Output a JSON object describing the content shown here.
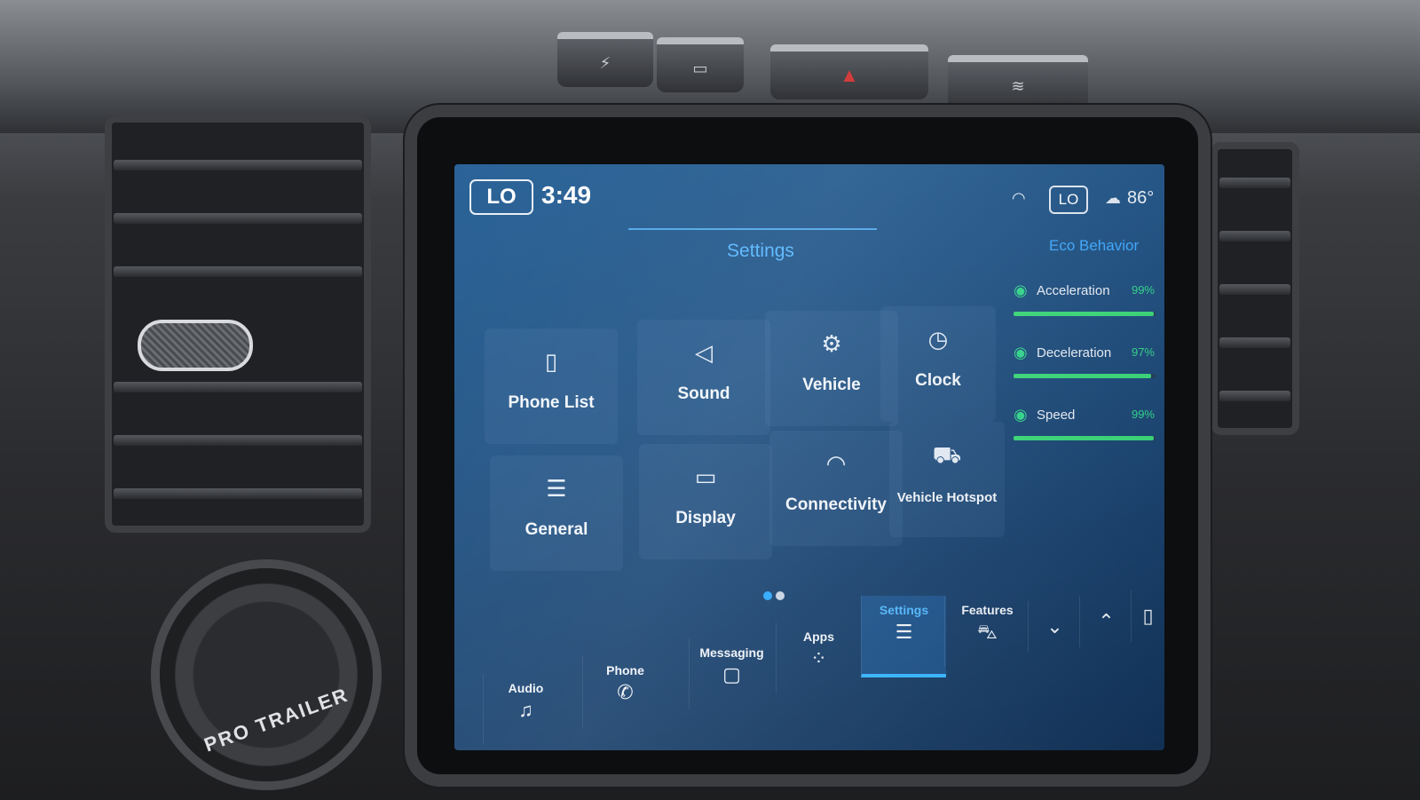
{
  "hardware": {
    "hazard_icon": "hazard-triangle-icon",
    "pro_trailer_label": "PRO TRAILER"
  },
  "status_bar": {
    "left_badge": "LO",
    "time": "3:49",
    "right_badge": "LO",
    "temperature": "86°"
  },
  "page": {
    "title": "Settings"
  },
  "tiles": [
    {
      "label": "Phone List",
      "icon": "phone-list-icon"
    },
    {
      "label": "Sound",
      "icon": "speaker-icon"
    },
    {
      "label": "Vehicle",
      "icon": "vehicle-settings-icon"
    },
    {
      "label": "Clock",
      "icon": "clock-icon"
    },
    {
      "label": "General",
      "icon": "sliders-icon"
    },
    {
      "label": "Display",
      "icon": "display-icon"
    },
    {
      "label": "Connectivity",
      "icon": "wifi-icon"
    },
    {
      "label": "Vehicle Hotspot",
      "icon": "hotspot-car-icon"
    }
  ],
  "eco": {
    "title": "Eco Behavior",
    "rows": [
      {
        "label": "Acceleration",
        "value": "99%",
        "level": 0.99
      },
      {
        "label": "Deceleration",
        "value": "97%",
        "level": 0.97
      },
      {
        "label": "Speed",
        "value": "99%",
        "level": 0.99
      }
    ],
    "accent": "#37d777"
  },
  "pagination": {
    "current": 1,
    "total": 2,
    "active_color": "#29a8ff",
    "inactive_color": "#c9d6e4"
  },
  "nav": {
    "items": [
      {
        "label": "Audio",
        "icon": "music-note-icon"
      },
      {
        "label": "Phone",
        "icon": "phone-icon"
      },
      {
        "label": "Messaging",
        "icon": "chat-icon"
      },
      {
        "label": "Apps",
        "icon": "apps-grid-icon"
      },
      {
        "label": "Settings",
        "icon": "sliders-icon",
        "active": true
      },
      {
        "label": "Features",
        "icon": "car-features-icon"
      }
    ],
    "buttons": [
      "collapse-down",
      "expand-up",
      "phone-projection"
    ]
  },
  "colors": {
    "screen_blue": "#1b4f82",
    "accent_blue": "#53b4ff",
    "eco_green": "#37d777"
  }
}
